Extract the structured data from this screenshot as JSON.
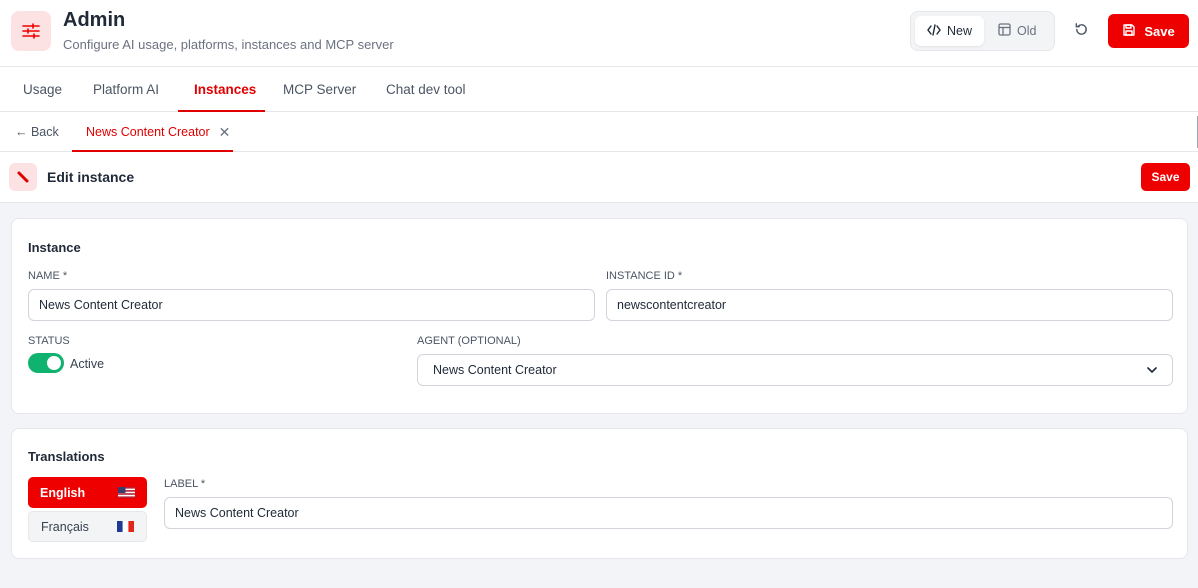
{
  "header": {
    "title": "Admin",
    "subtitle": "Configure AI usage, platforms, instances and MCP server",
    "app_icon": "sliders-icon",
    "view_toggle": {
      "new_label": "New",
      "old_label": "Old",
      "selected": "New"
    },
    "save_label": "Save"
  },
  "tabs": [
    {
      "label": "Usage"
    },
    {
      "label": "Platform AI"
    },
    {
      "label": "Instances",
      "active": true
    },
    {
      "label": "MCP Server"
    },
    {
      "label": "Chat dev tool"
    }
  ],
  "subtabs": {
    "back_label": "← Back",
    "open_tab": "News Content Creator"
  },
  "edit_bar": {
    "title": "Edit instance",
    "save_label": "Save"
  },
  "instance": {
    "section_title": "Instance",
    "name_label": "NAME *",
    "name_value": "News Content Creator",
    "id_label": "INSTANCE ID *",
    "id_value": "newscontentcreator",
    "status_label": "STATUS",
    "status_value": "Active",
    "status_on": true,
    "agent_label": "AGENT (OPTIONAL)",
    "agent_value": "News Content Creator"
  },
  "translations": {
    "section_title": "Translations",
    "languages": [
      {
        "label": "English",
        "flag": "us-flag-icon",
        "active": true
      },
      {
        "label": "Français",
        "flag": "fr-flag-icon",
        "active": false
      }
    ],
    "label_label": "LABEL *",
    "label_value": "News Content Creator"
  },
  "colors": {
    "accent": "#ef0000",
    "accent_light": "#fde2e3",
    "toggle_on": "#10b26f"
  }
}
